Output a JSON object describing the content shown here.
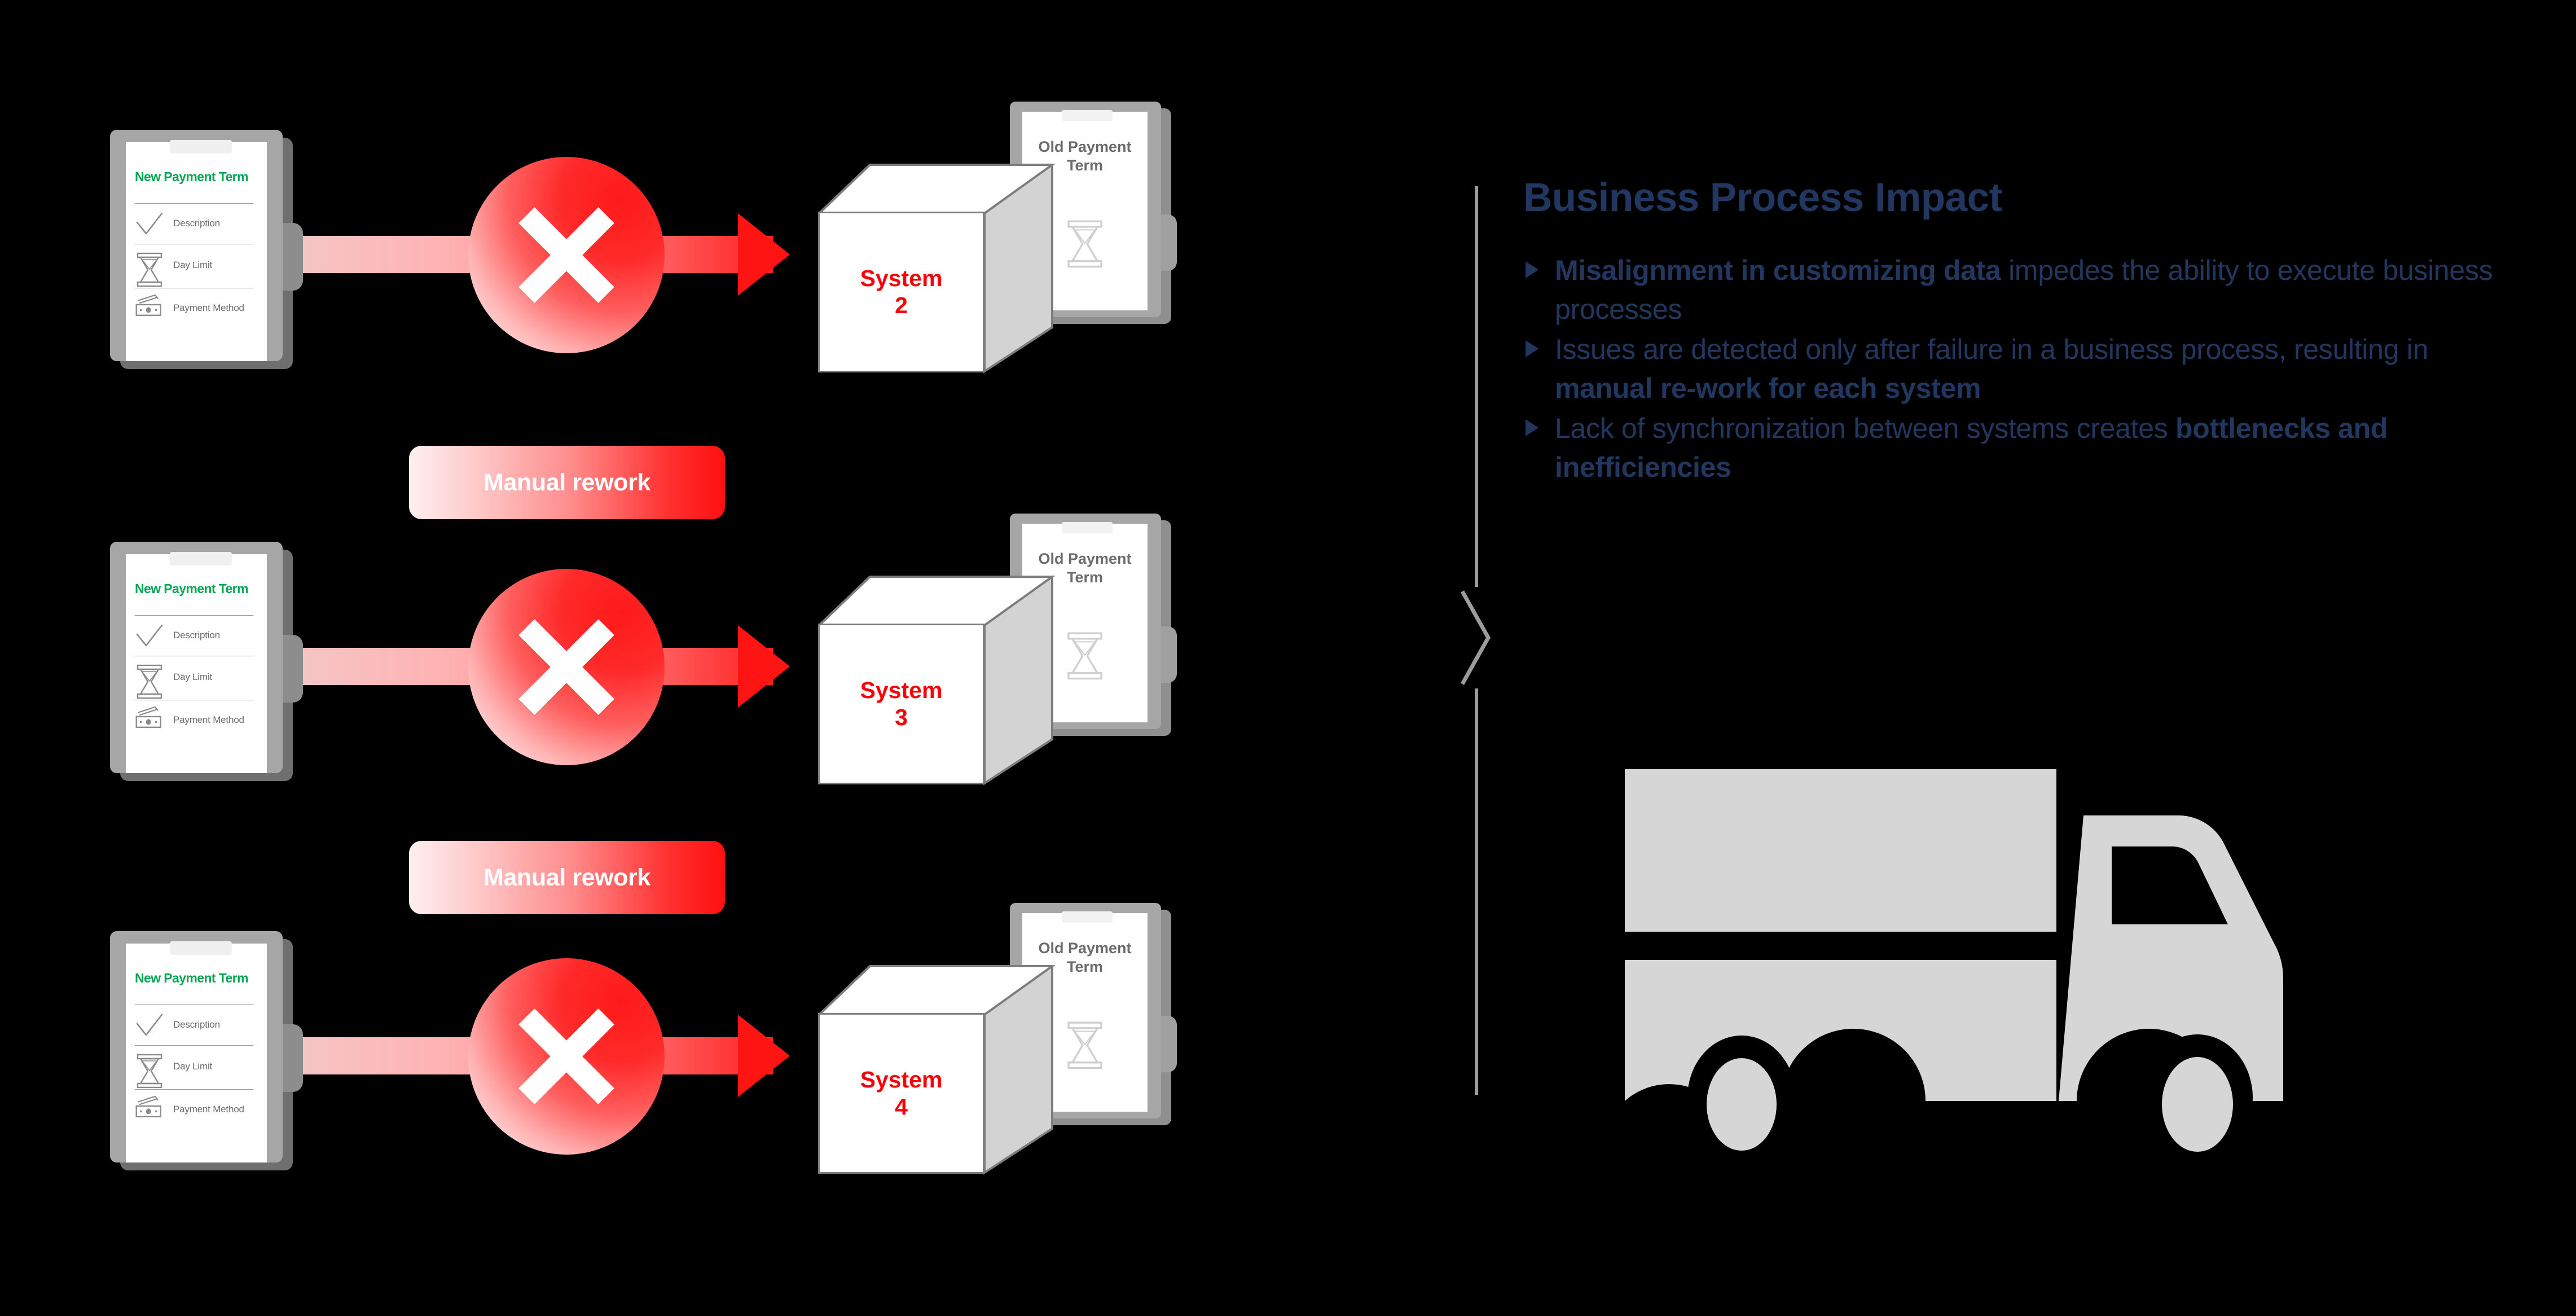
{
  "colors": {
    "background": "#000000",
    "heading": "#22375f",
    "body_text": "#22375f",
    "clipboard_title": "#00a651",
    "system_label": "#fb0007",
    "accent_red": "#ff0f0f",
    "divider": "#9c9c9c",
    "truck": "#d6d6d6",
    "doc_text": "#6b6b6b"
  },
  "diagram": {
    "rows": [
      {
        "clipboard": {
          "title": "New Payment Term",
          "fields": [
            {
              "icon": "checkmark-icon",
              "label": "Description"
            },
            {
              "icon": "hourglass-icon",
              "label": "Day Limit"
            },
            {
              "icon": "banknote-icon",
              "label": "Payment Method"
            }
          ]
        },
        "blocker_icon": "cross-x-icon",
        "system": {
          "name": "System",
          "number": "2"
        },
        "old_doc": {
          "title": "Old Payment Term",
          "icon": "hourglass-icon"
        },
        "rework_label": null
      },
      {
        "clipboard": {
          "title": "New Payment Term",
          "fields": [
            {
              "icon": "checkmark-icon",
              "label": "Description"
            },
            {
              "icon": "hourglass-icon",
              "label": "Day Limit"
            },
            {
              "icon": "banknote-icon",
              "label": "Payment Method"
            }
          ]
        },
        "blocker_icon": "cross-x-icon",
        "system": {
          "name": "System",
          "number": "3"
        },
        "old_doc": {
          "title": "Old Payment Term",
          "icon": "hourglass-icon"
        },
        "rework_label": "Manual rework"
      },
      {
        "clipboard": {
          "title": "New Payment Term",
          "fields": [
            {
              "icon": "checkmark-icon",
              "label": "Description"
            },
            {
              "icon": "hourglass-icon",
              "label": "Day Limit"
            },
            {
              "icon": "banknote-icon",
              "label": "Payment Method"
            }
          ]
        },
        "blocker_icon": "cross-x-icon",
        "system": {
          "name": "System",
          "number": "4"
        },
        "old_doc": {
          "title": "Old Payment Term",
          "icon": "hourglass-icon"
        },
        "rework_label": "Manual rework"
      }
    ]
  },
  "divider": {
    "icon": "chevron-right-icon"
  },
  "panel": {
    "title": "Business Process Impact",
    "bullets": [
      {
        "bullet_icon": "triangle-bullet-icon",
        "segments": [
          {
            "text": "Misalignment in customizing data ",
            "bold": true
          },
          {
            "text": "impedes the ability to execute business processes",
            "bold": false
          }
        ]
      },
      {
        "bullet_icon": "triangle-bullet-icon",
        "segments": [
          {
            "text": "Issues are detected only after failure in a business process, resulting in ",
            "bold": false
          },
          {
            "text": "manual re-work for each system",
            "bold": true
          }
        ]
      },
      {
        "bullet_icon": "triangle-bullet-icon",
        "segments": [
          {
            "text": "Lack of synchronization between systems creates ",
            "bold": false
          },
          {
            "text": "bottlenecks and inefficiencies",
            "bold": true
          }
        ]
      }
    ],
    "illustration": {
      "icon": "delivery-truck-icon"
    }
  }
}
